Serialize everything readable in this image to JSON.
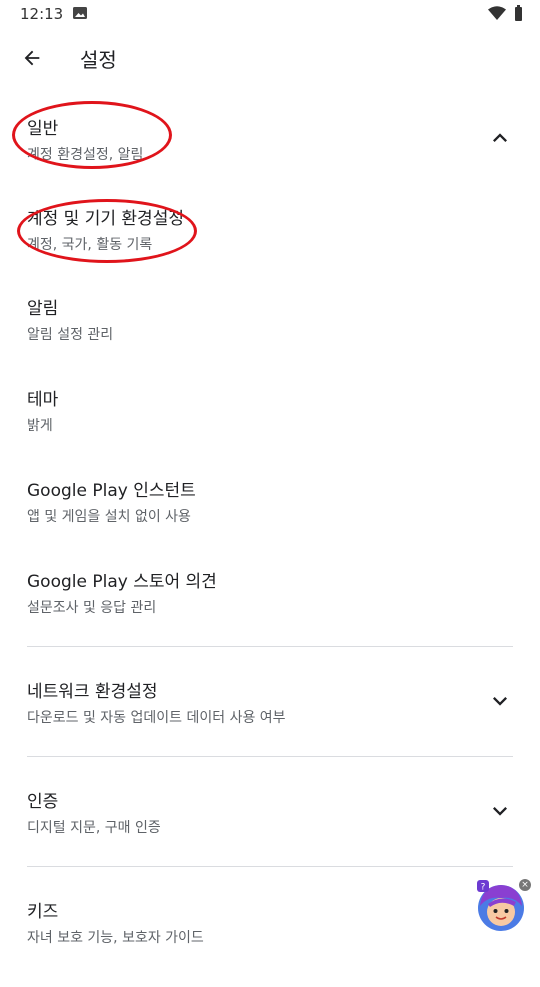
{
  "status_bar": {
    "time": "12:13"
  },
  "header": {
    "title": "설정"
  },
  "settings": {
    "general": {
      "title": "일반",
      "subtitle": "계정 환경설정, 알림"
    },
    "account": {
      "title": "계정 및 기기 환경설정",
      "subtitle": "계정, 국가, 활동 기록"
    },
    "notifications": {
      "title": "알림",
      "subtitle": "알림 설정 관리"
    },
    "theme": {
      "title": "테마",
      "subtitle": "밝게"
    },
    "instant": {
      "title": "Google Play 인스턴트",
      "subtitle": "앱 및 게임을 설치 없이 사용"
    },
    "opinion": {
      "title": "Google Play 스토어 의견",
      "subtitle": "설문조사 및 응답 관리"
    },
    "network": {
      "title": "네트워크 환경설정",
      "subtitle": "다운로드 및 자동 업데이트 데이터 사용 여부"
    },
    "auth": {
      "title": "인증",
      "subtitle": "디지털 지문, 구매 인증"
    },
    "kids": {
      "title": "키즈",
      "subtitle": "자녀 보호 기능, 보호자 가이드"
    }
  },
  "mascot": {
    "badge": "?"
  }
}
